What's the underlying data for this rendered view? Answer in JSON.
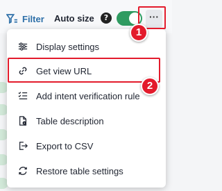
{
  "toolbar": {
    "filter_label": "Filter",
    "autosize_label": "Auto size",
    "help_glyph": "?",
    "autosize_on": true,
    "more_glyph": "···"
  },
  "annotations": {
    "step1": "1",
    "step2": "2",
    "highlight_color": "#e31b2c"
  },
  "menu": {
    "items": [
      {
        "label": "Display settings",
        "icon": "sliders-icon"
      },
      {
        "label": "Get view URL",
        "icon": "link-icon"
      },
      {
        "label": "Add intent verification rule",
        "icon": "checklist-icon"
      },
      {
        "label": "Table description",
        "icon": "document-info-icon"
      },
      {
        "label": "Export to CSV",
        "icon": "export-icon"
      },
      {
        "label": "Restore table settings",
        "icon": "restore-icon"
      }
    ]
  },
  "colors": {
    "accent": "#2d6fa8",
    "toggle_on": "#2f9b61"
  }
}
